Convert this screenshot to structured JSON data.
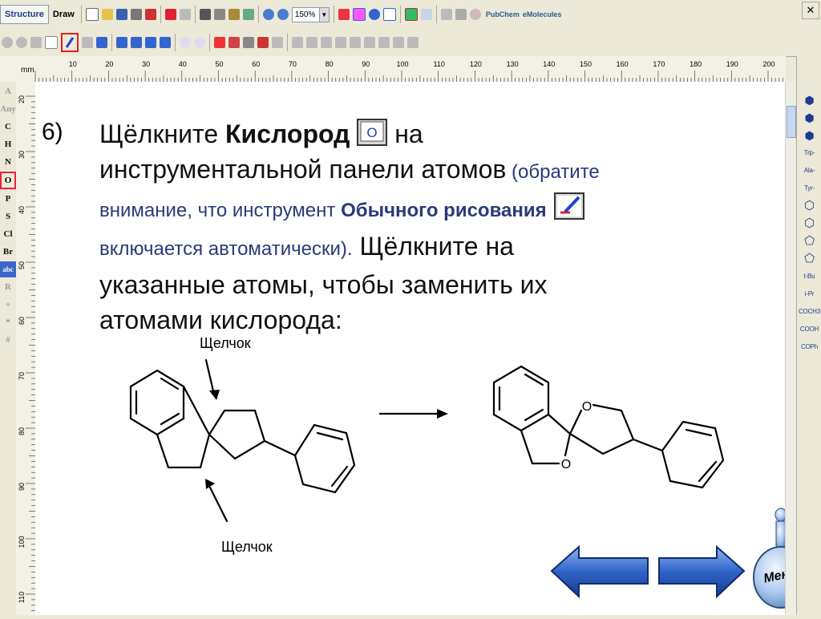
{
  "toolbar": {
    "tab_structure": "Structure",
    "tab_draw": "Draw",
    "zoom_value": "150%",
    "brand_pubchem": "PubChem",
    "brand_emolecules": "eMolecules"
  },
  "ruler": {
    "unit": "mm",
    "ticks": [
      "10",
      "20",
      "30",
      "40",
      "50",
      "60",
      "70",
      "80",
      "90",
      "100",
      "110",
      "120",
      "130",
      "140",
      "150",
      "160",
      "170",
      "180",
      "190",
      "200"
    ],
    "vticks": [
      "20",
      "30",
      "40",
      "50",
      "60",
      "70",
      "80",
      "90",
      "100",
      "110"
    ]
  },
  "left_palette": [
    "A",
    "Any",
    "C",
    "H",
    "N",
    "O",
    "P",
    "S",
    "Cl",
    "Br",
    "abc",
    "R",
    "+",
    "*",
    "#"
  ],
  "right_palette": [
    "Trp-",
    "Ala-",
    "Tyr-",
    "t-Bu",
    "i-Pr",
    "COCH3",
    "COOH",
    "COPh"
  ],
  "slide": {
    "step": "6)",
    "line1_a": "Щёлкните ",
    "line1_b": "Кислород",
    "line1_c": " на",
    "line2": "инструментальной панели атомов",
    "line2_small": " (обратите",
    "line3_small_a": "внимание, что инструмент ",
    "line3_small_b": "Обычного рисования",
    "line4_small": "включается автоматически).",
    "line4_rest": " Щёлкните на",
    "line5": "указанные атомы, чтобы заменить их",
    "line6": "атомами кислорода:",
    "oxygen_button_label": "O",
    "click_label_top": "Щелчок",
    "click_label_bottom": "Щелчок",
    "atom_o1": "O",
    "atom_o2": "O"
  },
  "nav": {
    "menu_label": "Меню",
    "back": "back-arrow-icon",
    "forward": "forward-arrow-icon"
  }
}
